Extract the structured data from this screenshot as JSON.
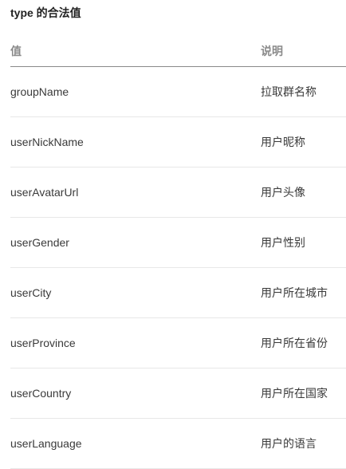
{
  "heading": "type 的合法值",
  "table": {
    "headers": {
      "value": "值",
      "description": "说明"
    },
    "rows": [
      {
        "value": "groupName",
        "description": "拉取群名称"
      },
      {
        "value": "userNickName",
        "description": "用户昵称"
      },
      {
        "value": "userAvatarUrl",
        "description": "用户头像"
      },
      {
        "value": "userGender",
        "description": "用户性别"
      },
      {
        "value": "userCity",
        "description": "用户所在城市"
      },
      {
        "value": "userProvince",
        "description": "用户所在省份"
      },
      {
        "value": "userCountry",
        "description": "用户所在国家"
      },
      {
        "value": "userLanguage",
        "description": "用户的语言"
      }
    ]
  }
}
